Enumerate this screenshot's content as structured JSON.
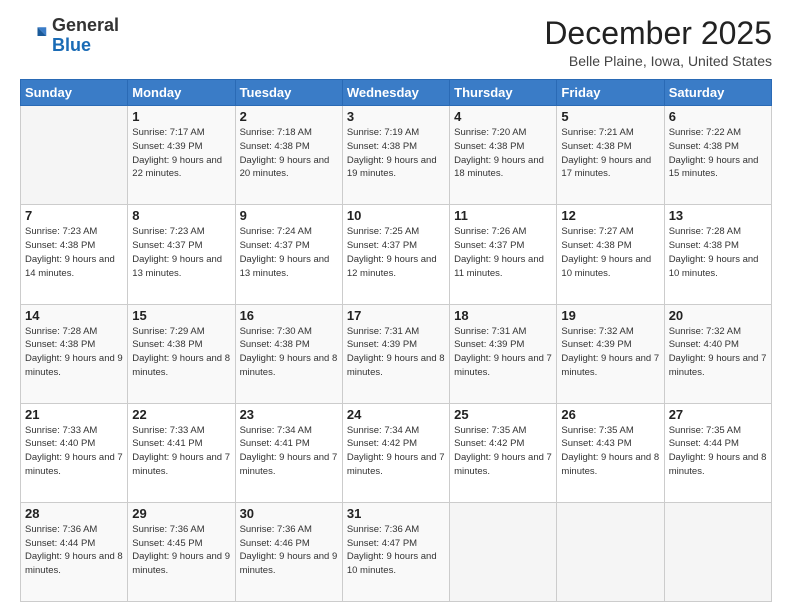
{
  "header": {
    "logo_general": "General",
    "logo_blue": "Blue",
    "month_title": "December 2025",
    "subtitle": "Belle Plaine, Iowa, United States"
  },
  "days_of_week": [
    "Sunday",
    "Monday",
    "Tuesday",
    "Wednesday",
    "Thursday",
    "Friday",
    "Saturday"
  ],
  "weeks": [
    [
      {
        "day": "",
        "info": ""
      },
      {
        "day": "1",
        "info": "Sunrise: 7:17 AM\nSunset: 4:39 PM\nDaylight: 9 hours\nand 22 minutes."
      },
      {
        "day": "2",
        "info": "Sunrise: 7:18 AM\nSunset: 4:38 PM\nDaylight: 9 hours\nand 20 minutes."
      },
      {
        "day": "3",
        "info": "Sunrise: 7:19 AM\nSunset: 4:38 PM\nDaylight: 9 hours\nand 19 minutes."
      },
      {
        "day": "4",
        "info": "Sunrise: 7:20 AM\nSunset: 4:38 PM\nDaylight: 9 hours\nand 18 minutes."
      },
      {
        "day": "5",
        "info": "Sunrise: 7:21 AM\nSunset: 4:38 PM\nDaylight: 9 hours\nand 17 minutes."
      },
      {
        "day": "6",
        "info": "Sunrise: 7:22 AM\nSunset: 4:38 PM\nDaylight: 9 hours\nand 15 minutes."
      }
    ],
    [
      {
        "day": "7",
        "info": "Sunrise: 7:23 AM\nSunset: 4:38 PM\nDaylight: 9 hours\nand 14 minutes."
      },
      {
        "day": "8",
        "info": "Sunrise: 7:23 AM\nSunset: 4:37 PM\nDaylight: 9 hours\nand 13 minutes."
      },
      {
        "day": "9",
        "info": "Sunrise: 7:24 AM\nSunset: 4:37 PM\nDaylight: 9 hours\nand 13 minutes."
      },
      {
        "day": "10",
        "info": "Sunrise: 7:25 AM\nSunset: 4:37 PM\nDaylight: 9 hours\nand 12 minutes."
      },
      {
        "day": "11",
        "info": "Sunrise: 7:26 AM\nSunset: 4:37 PM\nDaylight: 9 hours\nand 11 minutes."
      },
      {
        "day": "12",
        "info": "Sunrise: 7:27 AM\nSunset: 4:38 PM\nDaylight: 9 hours\nand 10 minutes."
      },
      {
        "day": "13",
        "info": "Sunrise: 7:28 AM\nSunset: 4:38 PM\nDaylight: 9 hours\nand 10 minutes."
      }
    ],
    [
      {
        "day": "14",
        "info": "Sunrise: 7:28 AM\nSunset: 4:38 PM\nDaylight: 9 hours\nand 9 minutes."
      },
      {
        "day": "15",
        "info": "Sunrise: 7:29 AM\nSunset: 4:38 PM\nDaylight: 9 hours\nand 8 minutes."
      },
      {
        "day": "16",
        "info": "Sunrise: 7:30 AM\nSunset: 4:38 PM\nDaylight: 9 hours\nand 8 minutes."
      },
      {
        "day": "17",
        "info": "Sunrise: 7:31 AM\nSunset: 4:39 PM\nDaylight: 9 hours\nand 8 minutes."
      },
      {
        "day": "18",
        "info": "Sunrise: 7:31 AM\nSunset: 4:39 PM\nDaylight: 9 hours\nand 7 minutes."
      },
      {
        "day": "19",
        "info": "Sunrise: 7:32 AM\nSunset: 4:39 PM\nDaylight: 9 hours\nand 7 minutes."
      },
      {
        "day": "20",
        "info": "Sunrise: 7:32 AM\nSunset: 4:40 PM\nDaylight: 9 hours\nand 7 minutes."
      }
    ],
    [
      {
        "day": "21",
        "info": "Sunrise: 7:33 AM\nSunset: 4:40 PM\nDaylight: 9 hours\nand 7 minutes."
      },
      {
        "day": "22",
        "info": "Sunrise: 7:33 AM\nSunset: 4:41 PM\nDaylight: 9 hours\nand 7 minutes."
      },
      {
        "day": "23",
        "info": "Sunrise: 7:34 AM\nSunset: 4:41 PM\nDaylight: 9 hours\nand 7 minutes."
      },
      {
        "day": "24",
        "info": "Sunrise: 7:34 AM\nSunset: 4:42 PM\nDaylight: 9 hours\nand 7 minutes."
      },
      {
        "day": "25",
        "info": "Sunrise: 7:35 AM\nSunset: 4:42 PM\nDaylight: 9 hours\nand 7 minutes."
      },
      {
        "day": "26",
        "info": "Sunrise: 7:35 AM\nSunset: 4:43 PM\nDaylight: 9 hours\nand 8 minutes."
      },
      {
        "day": "27",
        "info": "Sunrise: 7:35 AM\nSunset: 4:44 PM\nDaylight: 9 hours\nand 8 minutes."
      }
    ],
    [
      {
        "day": "28",
        "info": "Sunrise: 7:36 AM\nSunset: 4:44 PM\nDaylight: 9 hours\nand 8 minutes."
      },
      {
        "day": "29",
        "info": "Sunrise: 7:36 AM\nSunset: 4:45 PM\nDaylight: 9 hours\nand 9 minutes."
      },
      {
        "day": "30",
        "info": "Sunrise: 7:36 AM\nSunset: 4:46 PM\nDaylight: 9 hours\nand 9 minutes."
      },
      {
        "day": "31",
        "info": "Sunrise: 7:36 AM\nSunset: 4:47 PM\nDaylight: 9 hours\nand 10 minutes."
      },
      {
        "day": "",
        "info": ""
      },
      {
        "day": "",
        "info": ""
      },
      {
        "day": "",
        "info": ""
      }
    ]
  ]
}
